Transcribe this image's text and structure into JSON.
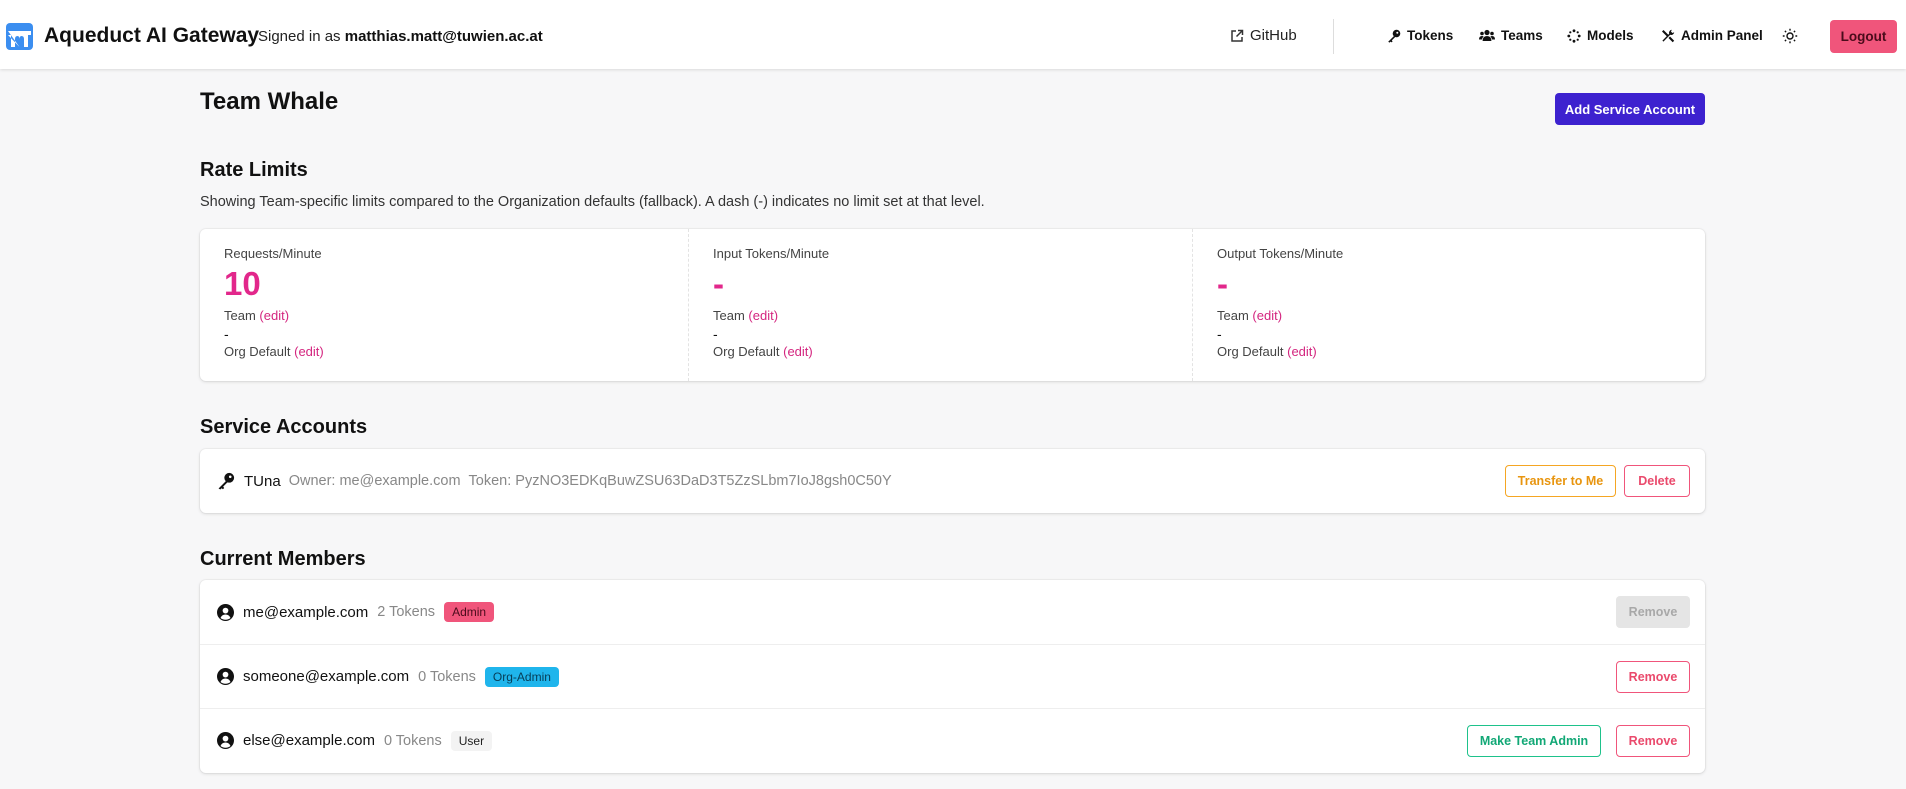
{
  "header": {
    "app_title": "Aqueduct AI Gateway",
    "signed_in_prefix": "Signed in as",
    "signed_in_user": "matthias.matt@tuwien.ac.at",
    "github_label": "GitHub",
    "nav": {
      "tokens": "Tokens",
      "teams": "Teams",
      "models": "Models",
      "admin_panel": "Admin Panel"
    },
    "logout_label": "Logout"
  },
  "page": {
    "title": "Team Whale",
    "add_service_account_label": "Add Service Account"
  },
  "rate_limits": {
    "title": "Rate Limits",
    "description": "Showing Team-specific limits compared to the Organization defaults (fallback). A dash (-) indicates no limit set at that level.",
    "columns": [
      {
        "label": "Requests/Minute",
        "value": "10",
        "team_label": "Team",
        "edit_label": "(edit)",
        "team_value": "-",
        "org_label": "Org Default",
        "org_edit_label": "(edit)"
      },
      {
        "label": "Input Tokens/Minute",
        "value": "-",
        "team_label": "Team",
        "edit_label": "(edit)",
        "team_value": "-",
        "org_label": "Org Default",
        "org_edit_label": "(edit)"
      },
      {
        "label": "Output Tokens/Minute",
        "value": "-",
        "team_label": "Team",
        "edit_label": "(edit)",
        "team_value": "-",
        "org_label": "Org Default",
        "org_edit_label": "(edit)"
      }
    ]
  },
  "service_accounts": {
    "title": "Service Accounts",
    "items": [
      {
        "name": "TUna",
        "owner": "Owner: me@example.com",
        "token": "Token: PyzNO3EDKqBuwZSU63DaD3T5ZzSLbm7IoJ8gsh0C50Y",
        "transfer_label": "Transfer to Me",
        "delete_label": "Delete"
      }
    ]
  },
  "members": {
    "title": "Current Members",
    "items": [
      {
        "email": "me@example.com",
        "tokens": "2 Tokens",
        "role": "Admin",
        "remove_label": "Remove"
      },
      {
        "email": "someone@example.com",
        "tokens": "0 Tokens",
        "role": "Org-Admin",
        "remove_label": "Remove"
      },
      {
        "email": "else@example.com",
        "tokens": "0 Tokens",
        "role": "User",
        "make_admin_label": "Make Team Admin",
        "remove_label": "Remove"
      }
    ]
  },
  "colors": {
    "accent_pink": "#e2278b",
    "primary_purple": "#3d22cf",
    "logout_pink": "#f0557b",
    "org_admin_blue": "#1fb5ec",
    "logo_blue": "#3b8ef0"
  }
}
